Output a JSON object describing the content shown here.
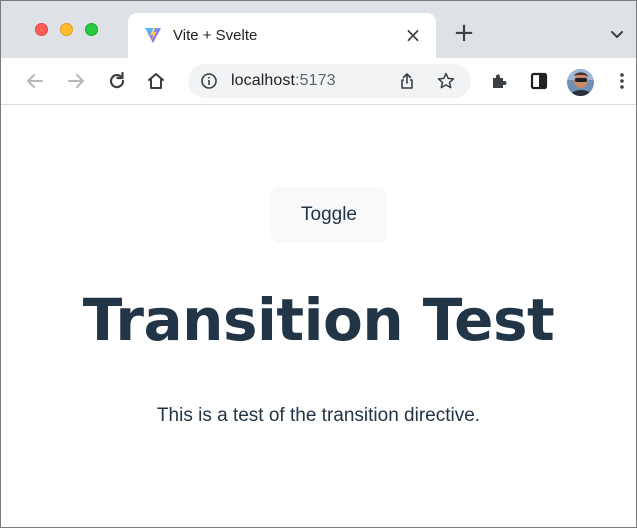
{
  "browser": {
    "tab": {
      "title": "Vite + Svelte",
      "favicon": "vite-logo-icon",
      "close_label": "×"
    },
    "new_tab_label": "+",
    "toolbar": {
      "back_icon": "back-arrow-icon",
      "forward_icon": "forward-arrow-icon",
      "reload_icon": "reload-icon",
      "home_icon": "home-icon",
      "extensions_icon": "puzzle-icon",
      "side_panel_icon": "side-panel-icon",
      "menu_icon": "kebab-menu-icon"
    },
    "address_bar": {
      "host": "localhost",
      "port": ":5173"
    }
  },
  "page": {
    "toggle_label": "Toggle",
    "heading": "Transition Test",
    "description": "This is a test of the transition directive."
  },
  "colors": {
    "text": "#213547",
    "button_bg": "#f9f9f9",
    "tabstrip_bg": "#dee1e6",
    "omnibox_bg": "#f1f3f4",
    "close_red": "#ff5f57",
    "minimize_yellow": "#febc2e",
    "zoom_green": "#28c840"
  }
}
